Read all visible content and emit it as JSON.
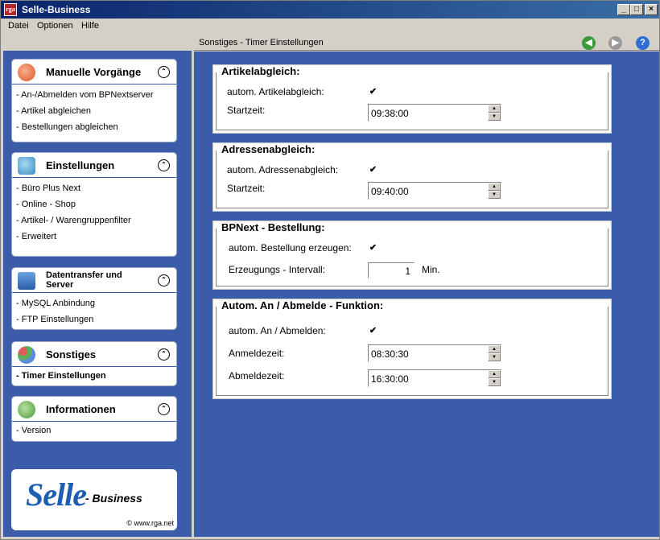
{
  "window": {
    "title": "Selle-Business",
    "app_icon_text": "rga",
    "controls": {
      "minimize": "_",
      "maximize": "□",
      "close": "×"
    }
  },
  "menu": {
    "items": [
      "Datei",
      "Optionen",
      "Hilfe"
    ]
  },
  "content_header": {
    "title": "Sonstiges - Timer Einstellungen",
    "icons": [
      "back-arrow-icon",
      "forward-icon",
      "help-icon"
    ],
    "help_glyph": "?",
    "back_glyph": "◀",
    "forward_glyph": "▶"
  },
  "sidebar": {
    "panels": [
      {
        "title": "Manuelle Vorgänge",
        "icon": "play-icon",
        "items": [
          "- An-/Abmelden vom BPNextserver",
          "- Artikel abgleichen",
          "- Bestellungen abgleichen"
        ]
      },
      {
        "title": "Einstellungen",
        "icon": "tools-icon",
        "items": [
          "- Büro Plus Next",
          "- Online - Shop",
          "- Artikel- / Warengruppenfilter",
          "- Erweitert"
        ]
      },
      {
        "title_line1": "Datentransfer und",
        "title_line2": "Server",
        "icon": "computer-icon",
        "items": [
          "- MySQL Anbindung",
          "- FTP Einstellungen"
        ]
      },
      {
        "title": "Sonstiges",
        "icon": "circles-icon",
        "items": [
          "- Timer Einstellungen"
        ]
      },
      {
        "title": "Informationen",
        "icon": "info-icon",
        "items": [
          "- Version"
        ]
      }
    ],
    "collapse_glyph": "⌃",
    "logo": {
      "main": "Selle",
      "sub": "- Business",
      "url": "© www.rga.net"
    }
  },
  "groups": {
    "artikel": {
      "legend": "Artikelabgleich:",
      "auto_label": "autom. Artikelabgleich:",
      "auto_checked": true,
      "time_label": "Startzeit:",
      "time_value": "09:38:00"
    },
    "adressen": {
      "legend": "Adressenabgleich:",
      "auto_label": "autom. Adressenabgleich:",
      "auto_checked": true,
      "time_label": "Startzeit:",
      "time_value": "09:40:00"
    },
    "bestellung": {
      "legend": "BPNext - Bestellung:",
      "auto_label": "autom. Bestellung erzeugen:",
      "auto_checked": true,
      "interval_label": "Erzeugungs - Intervall:",
      "interval_value": "1",
      "interval_unit": "Min."
    },
    "anmelde": {
      "legend": "Autom. An / Abmelde - Funktion:",
      "auto_label": "autom. An / Abmelden:",
      "auto_checked": true,
      "login_label": "Anmeldezeit:",
      "login_value": "08:30:30",
      "logout_label": "Abmeldezeit:",
      "logout_value": "16:30:00"
    }
  },
  "check_glyph": "✔",
  "spin_up_glyph": "▲",
  "spin_down_glyph": "▼",
  "colors": {
    "sidebar_bg": "#3b5ca8",
    "title_bar": "#0a246a",
    "back_icon": "#3a9a3a",
    "help_icon": "#2f6fd1"
  }
}
